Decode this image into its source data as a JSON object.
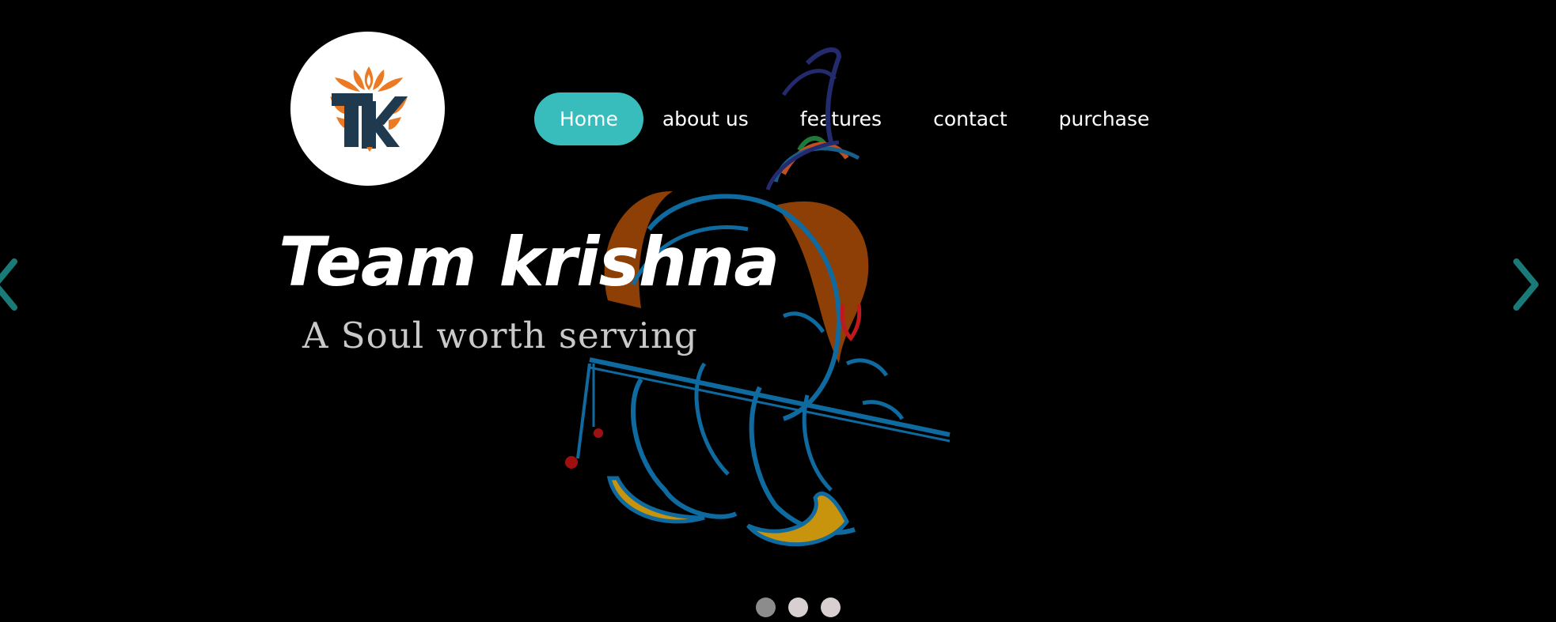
{
  "brand": {
    "logo_icon": "tk-lotus-logo-icon",
    "colors": {
      "orange": "#ec7a24",
      "navy": "#1f3a4e"
    }
  },
  "nav": {
    "items": [
      {
        "label": "Home",
        "active": true
      },
      {
        "label": "about us",
        "active": false
      },
      {
        "label": "features",
        "active": false
      },
      {
        "label": "contact",
        "active": false
      },
      {
        "label": "purchase",
        "active": false
      }
    ],
    "active_color": "#39bcbc"
  },
  "hero": {
    "title": "Team krishna",
    "subtitle": "A Soul worth serving",
    "illustration_icon": "krishna-flute-line-art-icon"
  },
  "carousel": {
    "prev_icon": "chevron-left-icon",
    "next_icon": "chevron-right-icon",
    "arrow_color": "#1a7a78",
    "slide_count": 3,
    "active_index": 0
  }
}
